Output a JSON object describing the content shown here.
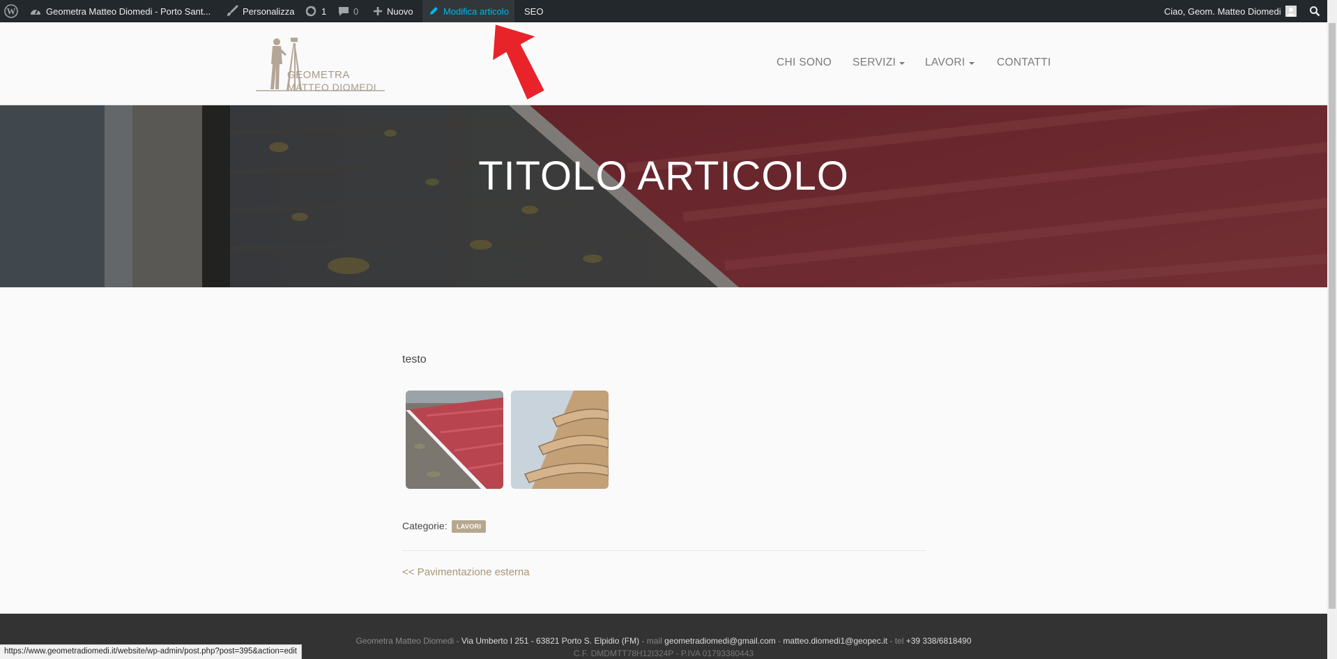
{
  "adminbar": {
    "site_name": "Geometra Matteo Diomedi - Porto Sant...",
    "customize": "Personalizza",
    "updates_count": "1",
    "comments_count": "0",
    "new": "Nuovo",
    "edit_post": "Modifica articolo",
    "seo": "SEO",
    "greeting": "Ciao, Geom. Matteo Diomedi"
  },
  "logo": {
    "line1": "GEOMETRA",
    "line2": "MATTEO DIOMEDI"
  },
  "nav": {
    "items": [
      {
        "label": "CHI SONO"
      },
      {
        "label": "SERVIZI"
      },
      {
        "label": "LAVORI"
      },
      {
        "label": "CONTATTI"
      }
    ]
  },
  "hero": {
    "title": "TITOLO ARTICOLO"
  },
  "post": {
    "text": "testo",
    "categories_label": "Categorie:",
    "category": "LAVORI",
    "prev_link": "<< Pavimentazione esterna"
  },
  "footer": {
    "name": "Geometra Matteo Diomedi",
    "sep": " - ",
    "address": "Via Umberto I 251 - 63821 Porto S. Elpidio (FM)",
    "mail_label": "mail",
    "email1": "geometradiomedi@gmail.com",
    "email2": "matteo.diomedi1@geopec.it",
    "tel_label": "tel",
    "phone": "+39 338/6818490",
    "line2": "C.F. DMDMTT78H12I324P - P.IVA 01793380443"
  },
  "statusbar": {
    "url": "https://www.geometradiomedi.it/website/wp-admin/post.php?post=395&action=edit"
  },
  "colors": {
    "adminbar_bg": "#23282d",
    "accent_link": "#00b9eb",
    "gold": "#a89572",
    "footer_bg": "#333333",
    "arrow_red": "#e8232a"
  },
  "icons": [
    "wordpress-icon",
    "dashboard-icon",
    "brush-icon",
    "updates-icon",
    "comment-icon",
    "plus-icon",
    "pencil-icon",
    "avatar-icon",
    "search-icon"
  ]
}
